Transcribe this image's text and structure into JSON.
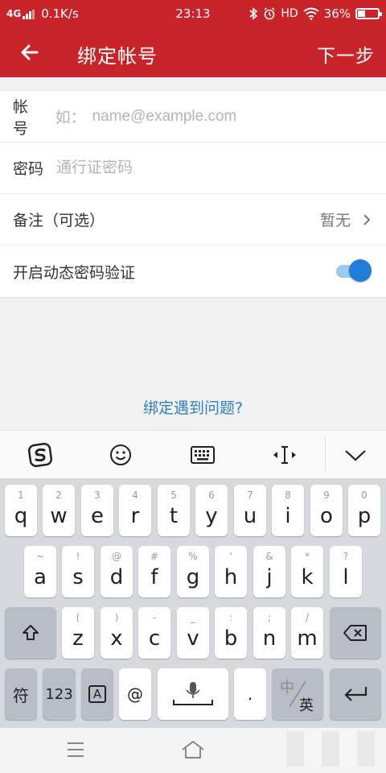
{
  "status_bar": {
    "network": "4G",
    "speed": "0.1K/s",
    "time": "23:13",
    "hd": "HD",
    "battery_percent": "36%",
    "battery_level": 0.36
  },
  "app_bar": {
    "title": "绑定帐号",
    "next_label": "下一步"
  },
  "form": {
    "account": {
      "label": "帐号",
      "prefix": "如：",
      "placeholder": "name@example.com"
    },
    "password": {
      "label": "密码",
      "placeholder": "通行证密码"
    },
    "note": {
      "label": "备注（可选）",
      "value": "暂无"
    },
    "dynamic_pwd": {
      "label": "开启动态密码验证",
      "enabled": true
    }
  },
  "help_link": "绑定遇到问题?",
  "keyboard": {
    "row1": [
      {
        "hint": "1",
        "key": "q"
      },
      {
        "hint": "2",
        "key": "w"
      },
      {
        "hint": "3",
        "key": "e"
      },
      {
        "hint": "4",
        "key": "r"
      },
      {
        "hint": "5",
        "key": "t"
      },
      {
        "hint": "6",
        "key": "y"
      },
      {
        "hint": "7",
        "key": "u"
      },
      {
        "hint": "8",
        "key": "i"
      },
      {
        "hint": "9",
        "key": "o"
      },
      {
        "hint": "0",
        "key": "p"
      }
    ],
    "row2": [
      {
        "hint": "~",
        "key": "a"
      },
      {
        "hint": "!",
        "key": "s"
      },
      {
        "hint": "@",
        "key": "d"
      },
      {
        "hint": "#",
        "key": "f"
      },
      {
        "hint": "%",
        "key": "g"
      },
      {
        "hint": "'",
        "key": "h"
      },
      {
        "hint": "&",
        "key": "j"
      },
      {
        "hint": "*",
        "key": "k"
      },
      {
        "hint": "?",
        "key": "l"
      }
    ],
    "row3": [
      {
        "hint": "(",
        "key": "z"
      },
      {
        "hint": ")",
        "key": "x"
      },
      {
        "hint": "-",
        "key": "c"
      },
      {
        "hint": "_",
        "key": "v"
      },
      {
        "hint": ":",
        "key": "b"
      },
      {
        "hint": ";",
        "key": "n"
      },
      {
        "hint": "/",
        "key": "m"
      }
    ],
    "symbols_label": "符",
    "numbers_label": "123",
    "emoji_label": "A",
    "at_label": "@",
    "period_label": ".",
    "lang_top": "中",
    "lang_bottom": "英"
  },
  "colors": {
    "brand_red": "#c8242a",
    "link_blue": "#2d7fc0",
    "toggle_blue": "#1e7ed8"
  }
}
